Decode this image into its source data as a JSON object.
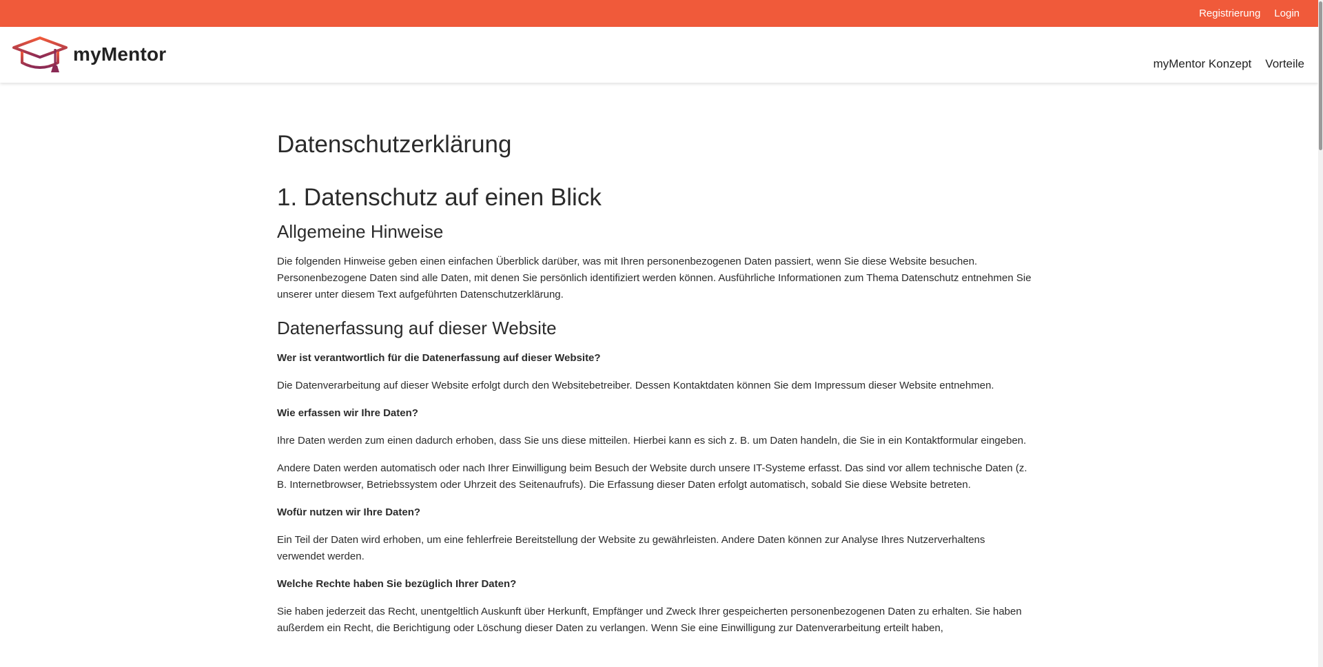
{
  "topbar": {
    "register_label": "Registrierung",
    "login_label": "Login"
  },
  "brand": {
    "name": "myMentor",
    "logo_icon": "graduation-cap-icon",
    "colors": {
      "primary": "#f05a3a",
      "secondary": "#8a2a55"
    }
  },
  "nav": {
    "items": [
      {
        "label": "myMentor Konzept"
      },
      {
        "label": "Vorteile"
      }
    ]
  },
  "page": {
    "title": "Datenschutzerklärung",
    "section1_title": "1. Datenschutz auf einen Blick",
    "general_heading": "Allgemeine Hinweise",
    "general_text": "Die folgenden Hinweise geben einen einfachen Überblick darüber, was mit Ihren personenbezogenen Daten passiert, wenn Sie diese Website besuchen. Personenbezogene Daten sind alle Daten, mit denen Sie persönlich identifiziert werden können. Ausführliche Informationen zum Thema Datenschutz entnehmen Sie unserer unter diesem Text aufgeführten Datenschutzerklärung.",
    "collection_heading": "Datenerfassung auf dieser Website",
    "q1": "Wer ist verantwortlich für die Datenerfassung auf dieser Website?",
    "a1": "Die Datenverarbeitung auf dieser Website erfolgt durch den Websitebetreiber. Dessen Kontaktdaten können Sie dem Impressum dieser Website entnehmen.",
    "q2": "Wie erfassen wir Ihre Daten?",
    "a2_1": "Ihre Daten werden zum einen dadurch erhoben, dass Sie uns diese mitteilen. Hierbei kann es sich z. B. um Daten handeln, die Sie in ein Kontaktformular eingeben.",
    "a2_2": "Andere Daten werden automatisch oder nach Ihrer Einwilligung beim Besuch der Website durch unsere IT-Systeme erfasst. Das sind vor allem technische Daten (z. B. Internetbrowser, Betriebssystem oder Uhrzeit des Seitenaufrufs). Die Erfassung dieser Daten erfolgt automatisch, sobald Sie diese Website betreten.",
    "q3": "Wofür nutzen wir Ihre Daten?",
    "a3": "Ein Teil der Daten wird erhoben, um eine fehlerfreie Bereitstellung der Website zu gewährleisten. Andere Daten können zur Analyse Ihres Nutzerverhaltens verwendet werden.",
    "q4": "Welche Rechte haben Sie bezüglich Ihrer Daten?",
    "a4": "Sie haben jederzeit das Recht, unentgeltlich Auskunft über Herkunft, Empfänger und Zweck Ihrer gespeicherten personenbezogenen Daten zu erhalten. Sie haben außerdem ein Recht, die Berichtigung oder Löschung dieser Daten zu verlangen. Wenn Sie eine Einwilligung zur Datenverarbeitung erteilt haben,"
  }
}
